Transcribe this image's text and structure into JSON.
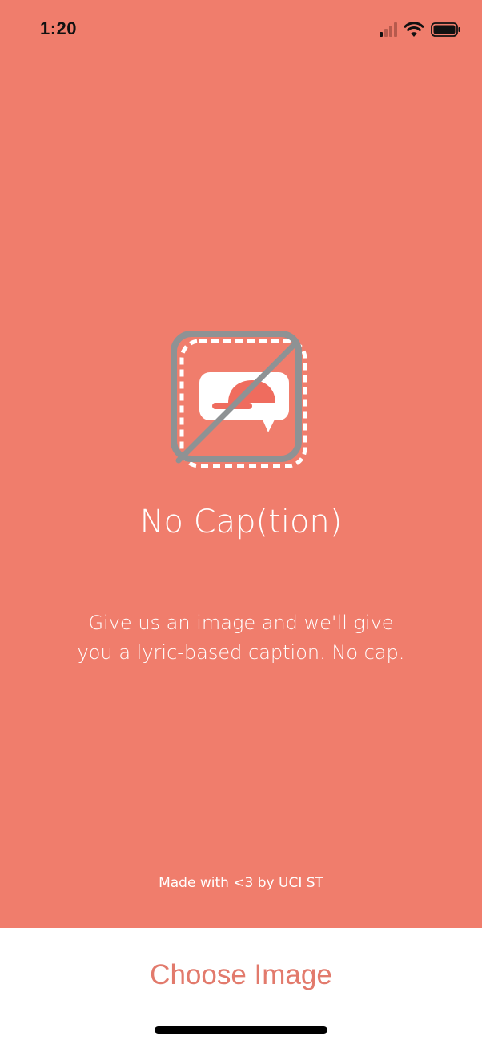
{
  "status_bar": {
    "time": "1:20",
    "signal_icon": "cellular-signal-icon",
    "wifi_icon": "wifi-icon",
    "battery_icon": "battery-icon"
  },
  "logo": {
    "icon": "no-caption-logo-icon"
  },
  "main": {
    "title": "No Cap(tion)",
    "description_line1": "Give us an image and we'll give",
    "description_line2": "you a lyric-based caption. No cap.",
    "credit": "Made with <3 by UCI ST"
  },
  "bottom": {
    "choose_button_label": "Choose Image"
  },
  "colors": {
    "background": "#F07D6C",
    "button_text": "#E27A6C",
    "logo_gray": "#8E9294"
  }
}
